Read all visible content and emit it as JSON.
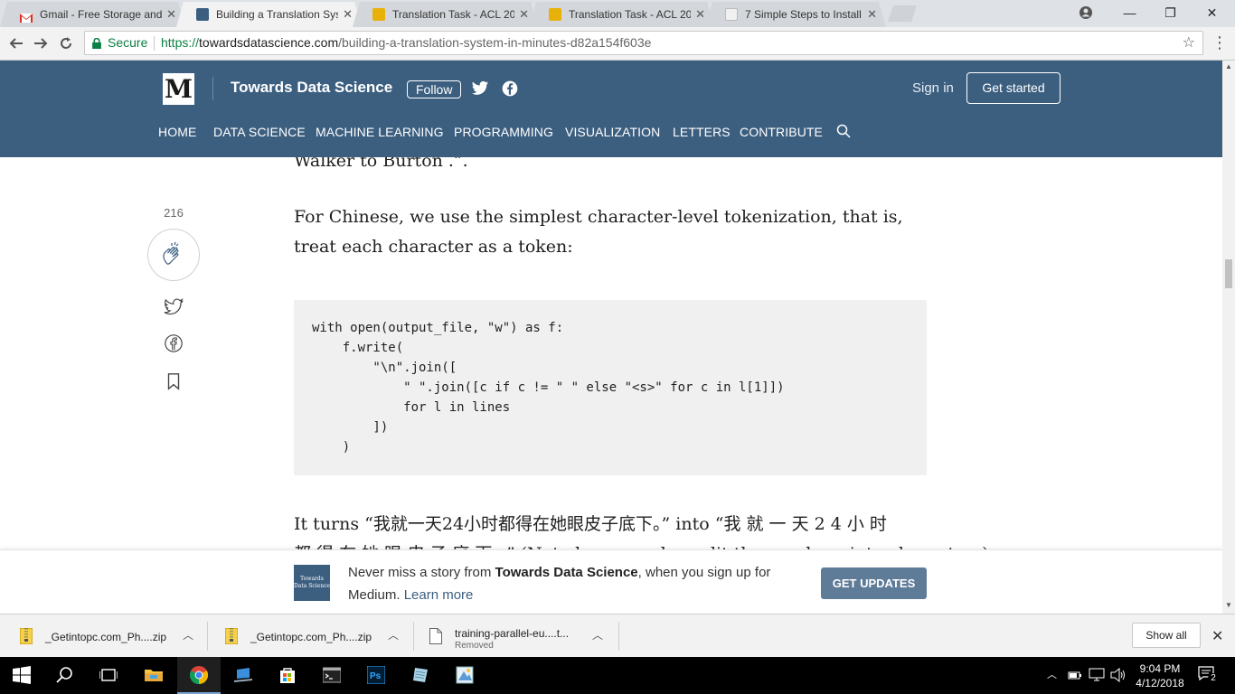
{
  "browser": {
    "tabs": [
      {
        "title": "Gmail - Free Storage and",
        "fav_color": "#d93025",
        "active": false
      },
      {
        "title": "Building a Translation Sys",
        "fav_color": "#3c5f80",
        "active": true
      },
      {
        "title": "Translation Task - ACL 20",
        "fav_color": "#e8b10a",
        "active": false
      },
      {
        "title": "Translation Task - ACL 20",
        "fav_color": "#e8b10a",
        "active": false
      },
      {
        "title": "7 Simple Steps to Install ",
        "fav_color": "#f0f0f0",
        "active": false
      }
    ],
    "tab_close": "✕",
    "window": {
      "minimize": "—",
      "maximize": "❐",
      "close": "✕"
    },
    "address": {
      "secure_label": "Secure",
      "url_scheme": "https://",
      "url_host": "towardsdatascience.com",
      "url_path": "/building-a-translation-system-in-minutes-d82a154f603e"
    }
  },
  "header": {
    "logo": "M",
    "publication": "Towards Data Science",
    "follow": "Follow",
    "sign_in": "Sign in",
    "get_started": "Get started",
    "nav": [
      "HOME",
      "DATA SCIENCE",
      "MACHINE LEARNING",
      "PROGRAMMING",
      "VISUALIZATION",
      "LETTERS",
      "CONTRIBUTE"
    ],
    "accent": "#3c5f80"
  },
  "article": {
    "partial_top": "Walker to Burton .”.",
    "para1": "For Chinese, we use the simplest character-level tokenization, that is, treat each character as a token:",
    "code": "with open(output_file, \"w\") as f:\n    f.write(\n        \"\\n\".join([\n            \" \".join([c if c != \" \" else \"<s>\" for c in l[1]])\n            for l in lines\n        ])\n    )",
    "para2_line1": "It turns “我就一天24小时都得在她眼皮子底下。” into “我 就 一 天 2 4 小 时",
    "para2_line2": "都 得 在 她 眼 皮 子 底 下 。” (Note here we also split the numbers into characters)",
    "claps": "216"
  },
  "banner": {
    "logo_text": "Towards Data Science",
    "text_pre": "Never miss a story from ",
    "text_bold": "Towards Data Science",
    "text_post": ", when you sign up for Medium. ",
    "learn_more": "Learn more",
    "get_updates": "GET UPDATES"
  },
  "downloads": {
    "items": [
      {
        "name": "_Getintopc.com_Ph....zip",
        "sub": ""
      },
      {
        "name": "_Getintopc.com_Ph....zip",
        "sub": ""
      },
      {
        "name": "training-parallel-eu....t...",
        "sub": "Removed"
      }
    ],
    "show_all": "Show all",
    "close": "✕"
  },
  "taskbar": {
    "time": "9:04 PM",
    "date": "4/12/2018",
    "notifications": "2"
  }
}
